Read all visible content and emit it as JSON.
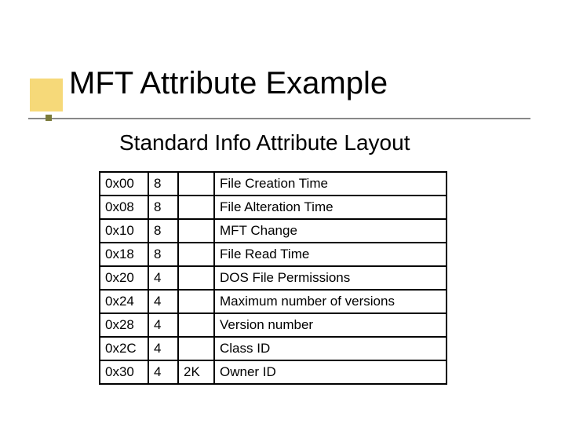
{
  "title": "MFT Attribute Example",
  "subtitle": "Standard Info Attribute Layout",
  "table": {
    "rows": [
      {
        "offset": "0x00",
        "size": "8",
        "extra": "",
        "desc": "File Creation Time"
      },
      {
        "offset": "0x08",
        "size": "8",
        "extra": "",
        "desc": "File Alteration Time"
      },
      {
        "offset": "0x10",
        "size": "8",
        "extra": "",
        "desc": "MFT Change"
      },
      {
        "offset": "0x18",
        "size": "8",
        "extra": "",
        "desc": "File Read Time"
      },
      {
        "offset": "0x20",
        "size": "4",
        "extra": "",
        "desc": "DOS File Permissions"
      },
      {
        "offset": "0x24",
        "size": "4",
        "extra": "",
        "desc": "Maximum number of versions"
      },
      {
        "offset": "0x28",
        "size": "4",
        "extra": "",
        "desc": "Version number"
      },
      {
        "offset": "0x2C",
        "size": "4",
        "extra": "",
        "desc": "Class ID"
      },
      {
        "offset": "0x30",
        "size": "4",
        "extra": "2K",
        "desc": "Owner ID"
      }
    ]
  }
}
